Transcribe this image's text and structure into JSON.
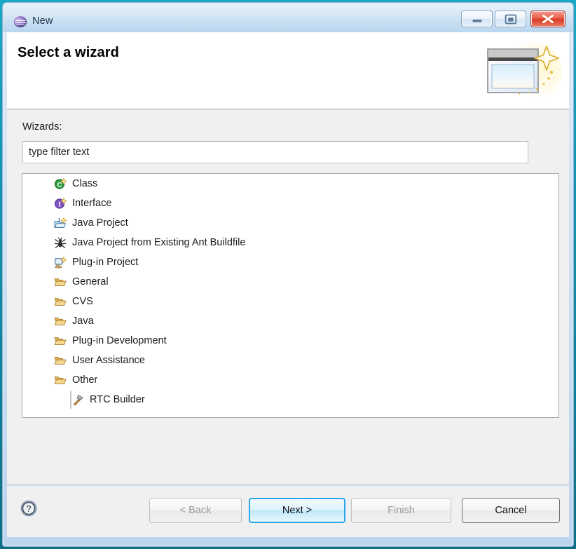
{
  "window": {
    "title": "New",
    "app_icon": "eclipse-sphere-icon",
    "controls": [
      {
        "name": "minimize-button",
        "icon": "minimize-icon"
      },
      {
        "name": "restore-button",
        "icon": "restore-icon"
      },
      {
        "name": "close-button",
        "icon": "close-icon"
      }
    ]
  },
  "header": {
    "title": "Select a wizard",
    "banner_icon": "new-wizard-sparkle-icon"
  },
  "body": {
    "wizards_label": "Wizards:",
    "filter": {
      "value": "",
      "placeholder": "type filter text"
    },
    "list": [
      {
        "label": "Class",
        "icon": "java-class-icon",
        "child": false,
        "selected": false
      },
      {
        "label": "Interface",
        "icon": "java-interface-icon",
        "child": false,
        "selected": false
      },
      {
        "label": "Java Project",
        "icon": "java-project-icon",
        "child": false,
        "selected": false
      },
      {
        "label": "Java Project from Existing Ant Buildfile",
        "icon": "ant-buildfile-icon",
        "child": false,
        "selected": false
      },
      {
        "label": "Plug-in Project",
        "icon": "plugin-project-icon",
        "child": false,
        "selected": false
      },
      {
        "label": "General",
        "icon": "folder-icon",
        "child": false,
        "selected": false
      },
      {
        "label": "CVS",
        "icon": "folder-icon",
        "child": false,
        "selected": false
      },
      {
        "label": "Java",
        "icon": "folder-icon",
        "child": false,
        "selected": false
      },
      {
        "label": "Plug-in Development",
        "icon": "folder-icon",
        "child": false,
        "selected": false
      },
      {
        "label": "User Assistance",
        "icon": "folder-icon",
        "child": false,
        "selected": false
      },
      {
        "label": "Other",
        "icon": "folder-icon",
        "child": false,
        "selected": false
      },
      {
        "label": "RTC Builder",
        "icon": "hammer-icon",
        "child": true,
        "selected": true
      }
    ]
  },
  "footer": {
    "help_icon": "help-question-icon",
    "buttons": [
      {
        "label": "< Back",
        "name": "back-button",
        "state": "disabled"
      },
      {
        "label": "Next >",
        "name": "next-button",
        "state": "default"
      },
      {
        "label": "Finish",
        "name": "finish-button",
        "state": "disabled"
      },
      {
        "label": "Cancel",
        "name": "cancel-button",
        "state": "enabled"
      }
    ]
  },
  "annotation": {
    "shape": "red-rounded-rectangle",
    "target": "RTC Builder",
    "color": "#ee0000"
  }
}
